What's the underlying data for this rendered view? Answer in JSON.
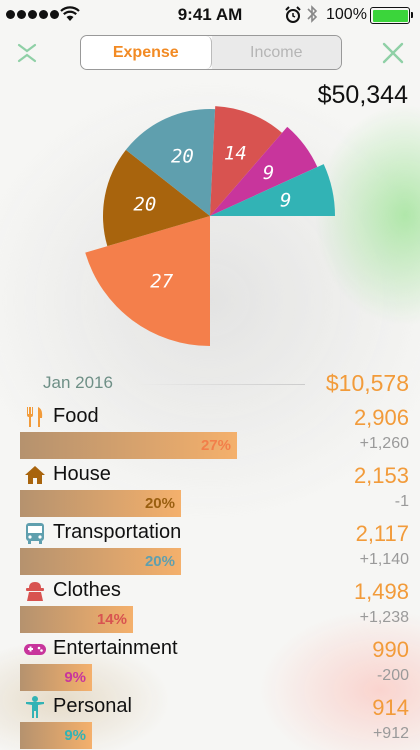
{
  "status_bar": {
    "time": "9:41 AM",
    "battery": "100%"
  },
  "header": {
    "tabs": [
      {
        "label": "Expense",
        "active": true
      },
      {
        "label": "Income",
        "active": false
      }
    ],
    "total": "$50,344"
  },
  "chart_data": {
    "type": "pie",
    "values": [
      27,
      20,
      20,
      14,
      9,
      9
    ],
    "labels": [
      "27",
      "20",
      "20",
      "14",
      "9",
      "9"
    ],
    "colors": [
      "#f47f4b",
      "#a8640d",
      "#5f9fae",
      "#d85350",
      "#c8359c",
      "#32b3b5"
    ],
    "categories": [
      "Food",
      "House",
      "Transportation",
      "Clothes",
      "Entertainment",
      "Personal"
    ]
  },
  "summary": {
    "month": "Jan 2016",
    "total": "$10,578"
  },
  "categories": [
    {
      "name": "Food",
      "amount": "2,906",
      "diff": "+1,260",
      "percent_label": "27%",
      "percent": 27,
      "pct_color": "#f27f4a",
      "icon": "fork-knife-icon",
      "icon_color": "#f29b3a"
    },
    {
      "name": "House",
      "amount": "2,153",
      "diff": "-1",
      "percent_label": "20%",
      "percent": 20,
      "pct_color": "#9a5f10",
      "icon": "house-icon",
      "icon_color": "#a8640d"
    },
    {
      "name": "Transportation",
      "amount": "2,117",
      "diff": "+1,140",
      "percent_label": "20%",
      "percent": 20,
      "pct_color": "#5f9fae",
      "icon": "bus-icon",
      "icon_color": "#5f9fae"
    },
    {
      "name": "Clothes",
      "amount": "1,498",
      "diff": "+1,238",
      "percent_label": "14%",
      "percent": 14,
      "pct_color": "#d85350",
      "icon": "clothes-icon",
      "icon_color": "#d85350"
    },
    {
      "name": "Entertainment",
      "amount": "990",
      "diff": "-200",
      "percent_label": "9%",
      "percent": 9,
      "pct_color": "#c8359c",
      "icon": "gamepad-icon",
      "icon_color": "#c8359c"
    },
    {
      "name": "Personal",
      "amount": "914",
      "diff": "+912",
      "percent_label": "9%",
      "percent": 9,
      "pct_color": "#32b3b5",
      "icon": "person-icon",
      "icon_color": "#32b3b5"
    }
  ]
}
